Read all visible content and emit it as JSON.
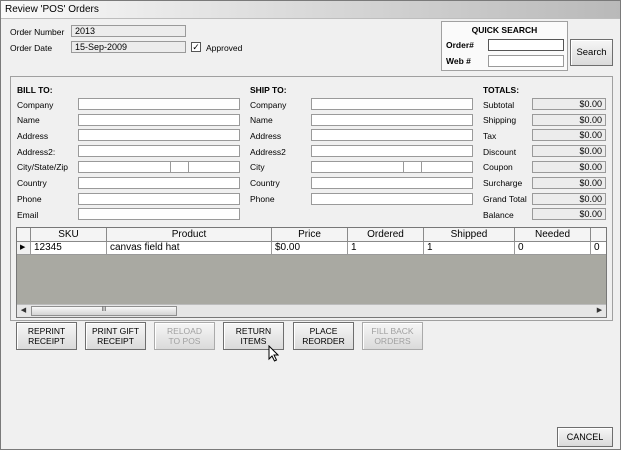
{
  "window": {
    "title": "Review 'POS' Orders"
  },
  "order": {
    "number_label": "Order Number",
    "number_value": "2013",
    "date_label": "Order Date",
    "date_value": "15-Sep-2009",
    "approved_label": "Approved",
    "approved_checked": true,
    "approved_mark": "✓"
  },
  "quick_search": {
    "title": "QUICK SEARCH",
    "order_label": "Order#",
    "order_value": "",
    "web_label": "Web #",
    "web_value": "",
    "search_button": "Search"
  },
  "bill_to": {
    "heading": "BILL TO:",
    "company": "Company",
    "name": "Name",
    "address": "Address",
    "address2": "Address2:",
    "city_state_zip": "City/State/Zip",
    "country": "Country",
    "phone": "Phone",
    "email": "Email"
  },
  "ship_to": {
    "heading": "SHIP TO:",
    "company": "Company",
    "name": "Name",
    "address": "Address",
    "address2": "Address2",
    "city": "City",
    "country": "Country",
    "phone": "Phone"
  },
  "totals": {
    "heading": "TOTALS:",
    "subtotal_label": "Subtotal",
    "subtotal": "$0.00",
    "shipping_label": "Shipping",
    "shipping": "$0.00",
    "tax_label": "Tax",
    "tax": "$0.00",
    "discount_label": "Discount",
    "discount": "$0.00",
    "coupon_label": "Coupon",
    "coupon": "$0.00",
    "surcharge_label": "Surcharge",
    "surcharge": "$0.00",
    "grand_total_label": "Grand Total",
    "grand_total": "$0.00",
    "balance_label": "Balance",
    "balance": "$0.00"
  },
  "grid": {
    "columns": [
      "SKU",
      "Product",
      "Price",
      "Ordered",
      "Shipped",
      "Needed"
    ],
    "rows": [
      {
        "sku": "12345",
        "product": "canvas field hat",
        "price": "$0.00",
        "ordered": "1",
        "shipped": "1",
        "needed": "0",
        "extra": "0"
      }
    ],
    "row_indicator": "▶",
    "scroll_left": "◀",
    "scroll_right": "▶",
    "scroll_grip": "III"
  },
  "actions": {
    "reprint_receipt": [
      "REPRINT",
      "RECEIPT"
    ],
    "print_gift_receipt": [
      "PRINT GIFT",
      "RECEIPT"
    ],
    "reload_to_pos": [
      "RELOAD",
      "TO POS"
    ],
    "return_items": [
      "RETURN",
      "ITEMS"
    ],
    "place_reorder": [
      "PLACE",
      "REORDER"
    ],
    "fill_back_orders": [
      "FILL BACK",
      "ORDERS"
    ]
  },
  "footer": {
    "cancel_button": "CANCEL"
  }
}
